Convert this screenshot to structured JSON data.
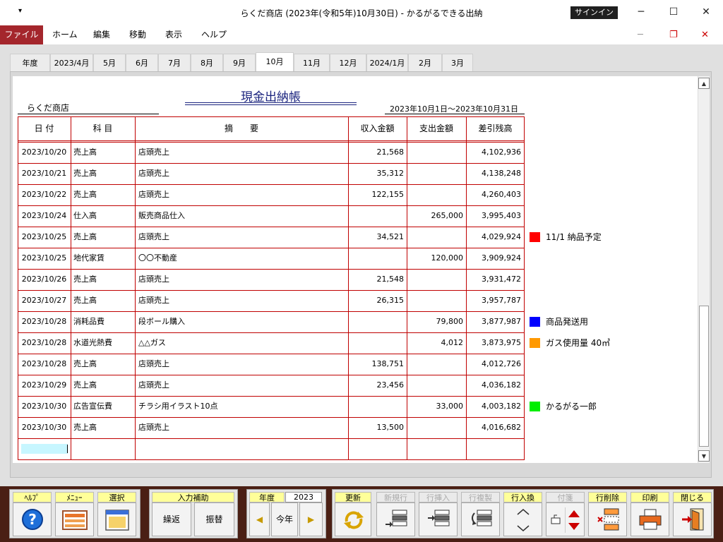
{
  "window": {
    "qa_icon": "quick-access-dropdown-icon",
    "title": "らくだ商店 (2023年(令和5年)10月30日) - かるがるできる出納",
    "signin": "サインイン",
    "minimize": "─",
    "maximize": "☐",
    "close": "✕",
    "inner_minimize": "─",
    "inner_restore": "❐",
    "inner_close": "✕"
  },
  "menu": [
    "ファイル",
    "ホーム",
    "編集",
    "移動",
    "表示",
    "ヘルプ"
  ],
  "tabs": [
    "年度",
    "2023/4月",
    "5月",
    "6月",
    "7月",
    "8月",
    "9月",
    "10月",
    "11月",
    "12月",
    "2024/1月",
    "2月",
    "3月"
  ],
  "active_tab": "10月",
  "ledger": {
    "shop": "らくだ商店",
    "title": "現金出納帳",
    "period": "2023年10月1日～2023年10月31日",
    "columns": [
      "日 付",
      "科 目",
      "摘　　要",
      "収入金額",
      "支出金額",
      "差引残高"
    ],
    "rows": [
      {
        "date": "2023/10/20",
        "account": "売上高",
        "desc": "店頭売上",
        "income": "21,568",
        "expense": "",
        "balance": "4,102,936"
      },
      {
        "date": "2023/10/21",
        "account": "売上高",
        "desc": "店頭売上",
        "income": "35,312",
        "expense": "",
        "balance": "4,138,248"
      },
      {
        "date": "2023/10/22",
        "account": "売上高",
        "desc": "店頭売上",
        "income": "122,155",
        "expense": "",
        "balance": "4,260,403"
      },
      {
        "date": "2023/10/24",
        "account": "仕入高",
        "desc": "販売商品仕入",
        "income": "",
        "expense": "265,000",
        "balance": "3,995,403"
      },
      {
        "date": "2023/10/25",
        "account": "売上高",
        "desc": "店頭売上",
        "income": "34,521",
        "expense": "",
        "balance": "4,029,924"
      },
      {
        "date": "2023/10/25",
        "account": "地代家賃",
        "desc": "〇〇不動産",
        "income": "",
        "expense": "120,000",
        "balance": "3,909,924"
      },
      {
        "date": "2023/10/26",
        "account": "売上高",
        "desc": "店頭売上",
        "income": "21,548",
        "expense": "",
        "balance": "3,931,472"
      },
      {
        "date": "2023/10/27",
        "account": "売上高",
        "desc": "店頭売上",
        "income": "26,315",
        "expense": "",
        "balance": "3,957,787"
      },
      {
        "date": "2023/10/28",
        "account": "消耗品費",
        "desc": "段ボール購入",
        "income": "",
        "expense": "79,800",
        "balance": "3,877,987"
      },
      {
        "date": "2023/10/28",
        "account": "水道光熱費",
        "desc": "△△ガス",
        "income": "",
        "expense": "4,012",
        "balance": "3,873,975"
      },
      {
        "date": "2023/10/28",
        "account": "売上高",
        "desc": "店頭売上",
        "income": "138,751",
        "expense": "",
        "balance": "4,012,726"
      },
      {
        "date": "2023/10/29",
        "account": "売上高",
        "desc": "店頭売上",
        "income": "23,456",
        "expense": "",
        "balance": "4,036,182"
      },
      {
        "date": "2023/10/30",
        "account": "広告宣伝費",
        "desc": "チラシ用イラスト10点",
        "income": "",
        "expense": "33,000",
        "balance": "4,003,182"
      },
      {
        "date": "2023/10/30",
        "account": "売上高",
        "desc": "店頭売上",
        "income": "13,500",
        "expense": "",
        "balance": "4,016,682"
      }
    ],
    "memos": [
      {
        "row": 4,
        "color": "#ff0000",
        "text": "11/1 納品予定"
      },
      {
        "row": 8,
        "color": "#0000ff",
        "text": "商品発送用"
      },
      {
        "row": 9,
        "color": "#ff9900",
        "text": "ガス使用量 40㎥"
      },
      {
        "row": 12,
        "color": "#00ee00",
        "text": "かるがる一郎"
      }
    ]
  },
  "toolbar": {
    "help": "ﾍﾙﾌﾟ",
    "menu": "ﾒﾆｭｰ",
    "select": "選択",
    "input_assist": "入力補助",
    "carry": "繰返",
    "transfer": "振替",
    "year_label": "年度",
    "year_value": "2023",
    "prev": "◀",
    "this_year": "今年",
    "next": "▶",
    "refresh": "更新",
    "new_row": "新規行",
    "insert_row": "行挿入",
    "copy_row": "行複製",
    "swap_row": "行入換",
    "tag": "付箋",
    "delete_row": "行削除",
    "print": "印刷",
    "close": "閉じる"
  }
}
